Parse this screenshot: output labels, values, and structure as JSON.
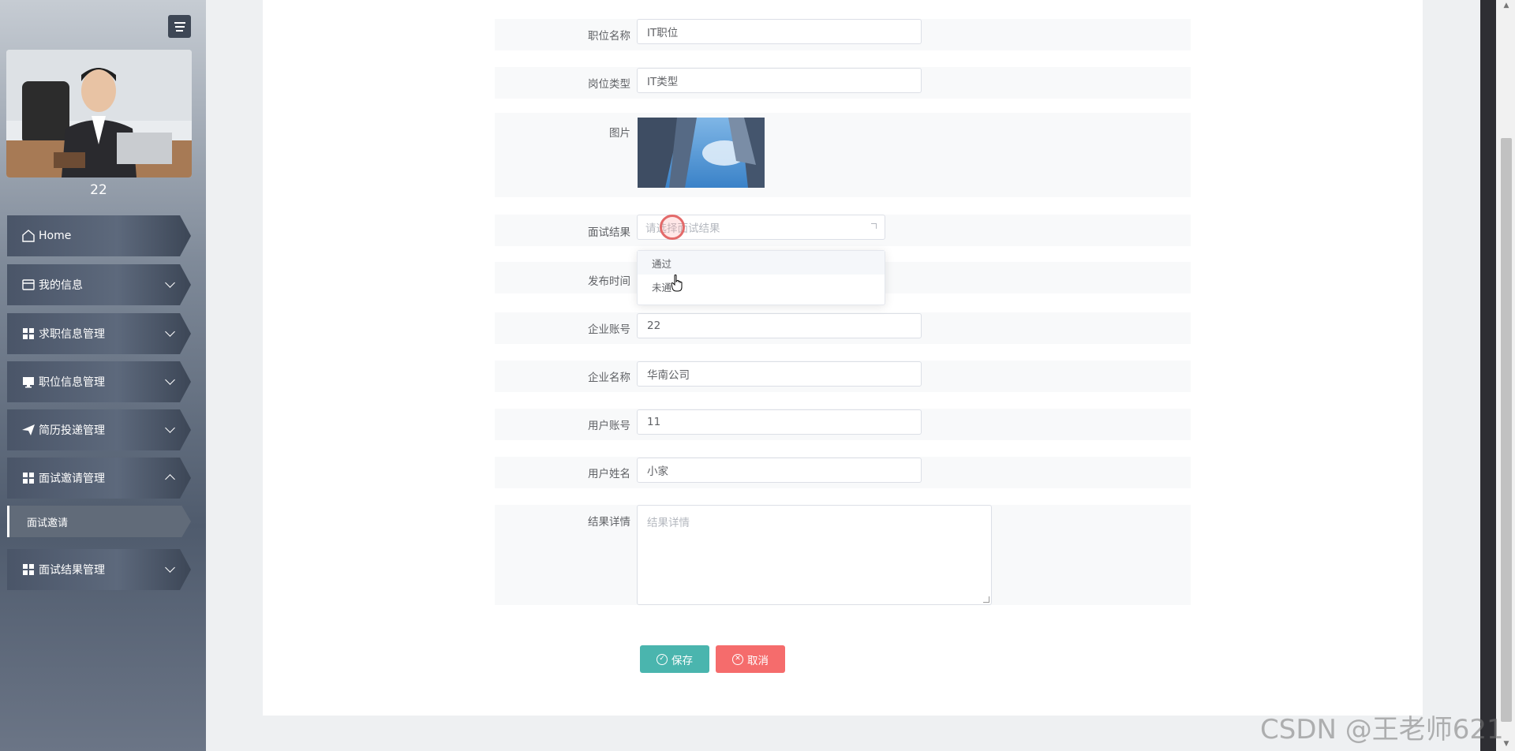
{
  "sidebar": {
    "username": "22",
    "items": [
      {
        "label": "Home",
        "icon": "home-icon"
      },
      {
        "label": "我的信息",
        "icon": "wallet-icon"
      },
      {
        "label": "求职信息管理",
        "icon": "grid-icon"
      },
      {
        "label": "职位信息管理",
        "icon": "monitor-icon"
      },
      {
        "label": "简历投递管理",
        "icon": "send-icon"
      },
      {
        "label": "面试邀请管理",
        "icon": "grid-icon"
      },
      {
        "label": "面试结果管理",
        "icon": "grid-icon"
      }
    ],
    "sub_item": "面试邀请"
  },
  "form": {
    "position_name": {
      "label": "职位名称",
      "value": "IT职位"
    },
    "position_type": {
      "label": "岗位类型",
      "value": "IT类型"
    },
    "picture": {
      "label": "图片"
    },
    "interview_result": {
      "label": "面试结果",
      "placeholder": "请选择面试结果"
    },
    "publish_time": {
      "label": "发布时间"
    },
    "company_account": {
      "label": "企业账号",
      "value": "22"
    },
    "company_name": {
      "label": "企业名称",
      "value": "华南公司"
    },
    "user_account": {
      "label": "用户账号",
      "value": "11"
    },
    "user_name": {
      "label": "用户姓名",
      "value": "小家"
    },
    "result_detail": {
      "label": "结果详情",
      "placeholder": "结果详情"
    }
  },
  "dropdown": {
    "options": [
      "通过",
      "未通"
    ]
  },
  "buttons": {
    "save": "保存",
    "cancel": "取消"
  },
  "watermark": "CSDN @王老师621"
}
